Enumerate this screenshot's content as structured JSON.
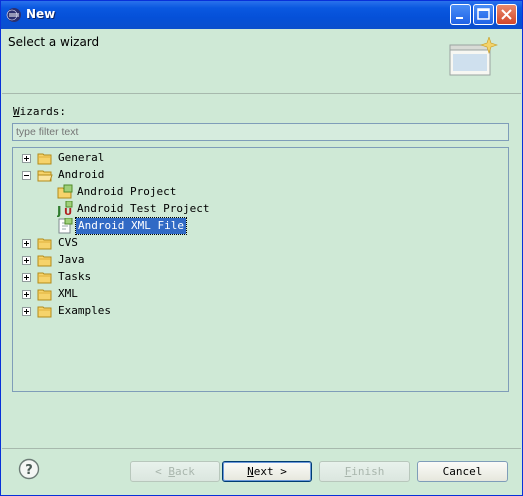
{
  "window": {
    "title": "New"
  },
  "header": {
    "title": "Select a wizard"
  },
  "wizards": {
    "label_prefix": "W",
    "label_rest": "izards:",
    "filter_placeholder": "type filter text"
  },
  "tree": {
    "general": "General",
    "android": "Android",
    "android_project": "Android Project",
    "android_test_project": "Android Test Project",
    "android_xml_file": "Android XML File",
    "cvs": "CVS",
    "java": "Java",
    "tasks": "Tasks",
    "xml": "XML",
    "examples": "Examples"
  },
  "buttons": {
    "back_prefix": "< ",
    "back_key": "B",
    "back_rest": "ack",
    "next_key": "N",
    "next_rest": "ext >",
    "finish_key": "F",
    "finish_rest": "inish",
    "cancel": "Cancel"
  },
  "colors": {
    "accent": "#0550d8",
    "selection": "#316ac5",
    "background": "#cfe9d6"
  }
}
